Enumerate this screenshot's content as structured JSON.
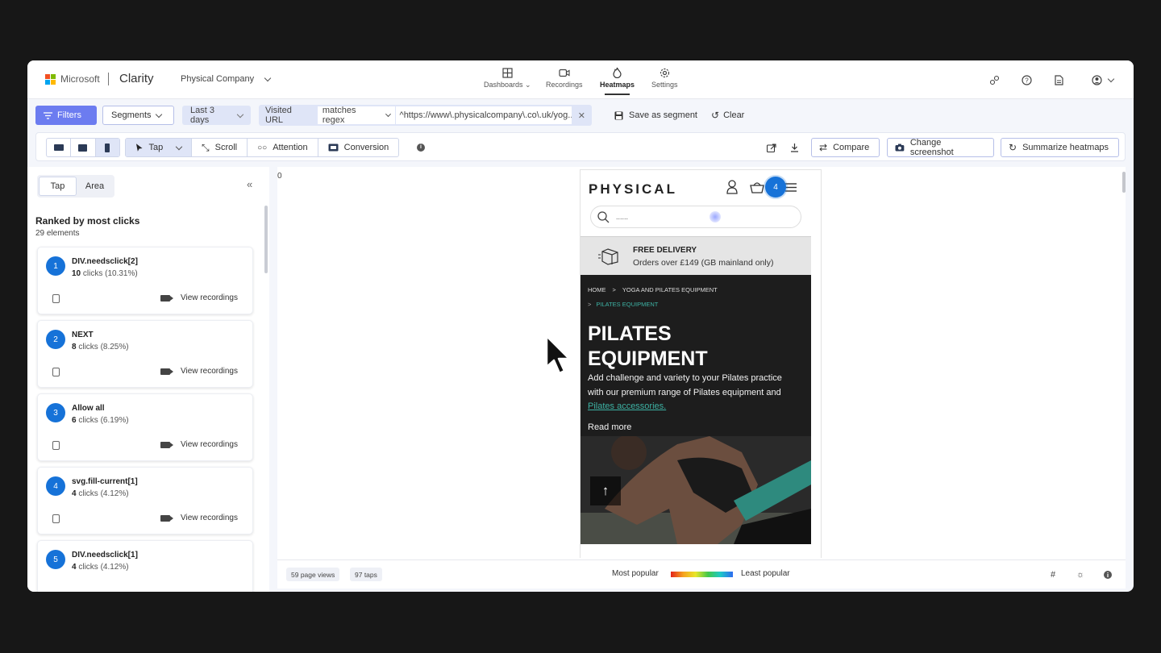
{
  "brand": {
    "company": "Microsoft",
    "app": "Clarity",
    "project": "Physical Company"
  },
  "nav": [
    {
      "label": "Dashboards",
      "icon": "dashboard-icon",
      "active": false
    },
    {
      "label": "Recordings",
      "icon": "video-icon",
      "active": false
    },
    {
      "label": "Heatmaps",
      "icon": "flame-icon",
      "active": true
    },
    {
      "label": "Settings",
      "icon": "gear-icon",
      "active": false
    }
  ],
  "filterbar": {
    "filters": "Filters",
    "segments": "Segments",
    "date_range": "Last 3 days",
    "url_filter_label": "Visited URL",
    "url_operator": "matches regex",
    "url_value": "^https://www\\.physicalcompany\\.co\\.uk/yog...",
    "save_segment": "Save as segment",
    "clear": "Clear"
  },
  "toolbar": {
    "modes": [
      "Tap",
      "Scroll",
      "Attention",
      "Conversion"
    ],
    "selected_mode": "Tap",
    "compare": "Compare",
    "change_screenshot": "Change screenshot",
    "summarize": "Summarize heatmaps"
  },
  "panel": {
    "tabs": [
      "Tap",
      "Area"
    ],
    "selected_tab": "Tap",
    "heading": "Ranked by most clicks",
    "element_count": "29 elements",
    "view_recordings": "View recordings",
    "items": [
      {
        "rank": "1",
        "name": "DIV.needsclick[2]",
        "clicks": "10",
        "clicks_suffix": "clicks (10.31%)"
      },
      {
        "rank": "2",
        "name": "NEXT",
        "clicks": "8",
        "clicks_suffix": "clicks (8.25%)"
      },
      {
        "rank": "3",
        "name": "Allow all",
        "clicks": "6",
        "clicks_suffix": "clicks (6.19%)"
      },
      {
        "rank": "4",
        "name": "svg.fill-current[1]",
        "clicks": "4",
        "clicks_suffix": "clicks (4.12%)"
      },
      {
        "rank": "5",
        "name": "DIV.needsclick[1]",
        "clicks": "4",
        "clicks_suffix": "clicks (4.12%)"
      }
    ]
  },
  "canvas": {
    "scroll_depth_label": "0"
  },
  "site": {
    "logo": "PHYSICAL",
    "tap_badge": "4",
    "search_placeholder": "......",
    "delivery_title": "FREE DELIVERY",
    "delivery_sub": "Orders over £149 (GB mainland only)",
    "breadcrumb": [
      "HOME",
      "YOGA AND PILATES EQUIPMENT"
    ],
    "breadcrumb_current": "PILATES EQUIPMENT",
    "title_line1": "PILATES",
    "title_line2": "EQUIPMENT",
    "description": "Add challenge and variety to your Pilates practice with our premium range of Pilates equipment and ",
    "description_link": "Pilates accessories.",
    "read_more": "Read more"
  },
  "footer": {
    "page_views": "59 page views",
    "taps": "97 taps",
    "most_popular": "Most popular",
    "least_popular": "Least popular"
  },
  "colors": {
    "accent": "#6c7cf0",
    "rank_blue": "#1672d8",
    "link_teal": "#3db2a4"
  }
}
